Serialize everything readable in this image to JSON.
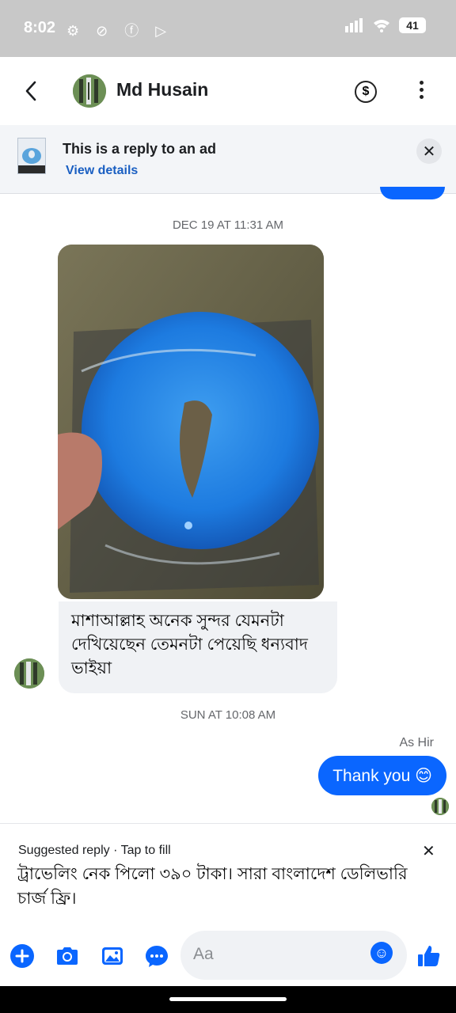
{
  "status": {
    "time": "8:02",
    "battery": "41"
  },
  "header": {
    "contact_name": "Md Husain"
  },
  "ad_banner": {
    "title": "This is a reply to an ad",
    "link": "View details"
  },
  "thread": {
    "timestamp_1": "DEC 19 AT 11:31 AM",
    "incoming_text": "মাশাআল্লাহ অনেক সুন্দর যেমনটা দেখিয়েছেন তেমনটা পেয়েছি ধন্যবাদ ভাইয়া",
    "timestamp_2": "SUN AT 10:08 AM",
    "sender_label": "As Hir",
    "outgoing_text": "Thank you 😊"
  },
  "suggested_reply": {
    "label": "Suggested reply · Tap to fill",
    "text": "ট্রাভেলিং নেক পিলো ৩৯০ টাকা। সারা বাংলাদেশ ডেলিভারি চার্জ ফ্রি।"
  },
  "composer": {
    "placeholder": "Aa"
  },
  "colors": {
    "accent": "#0a66ff",
    "bubble_in": "#f0f2f5",
    "link": "#1a5fc2"
  }
}
